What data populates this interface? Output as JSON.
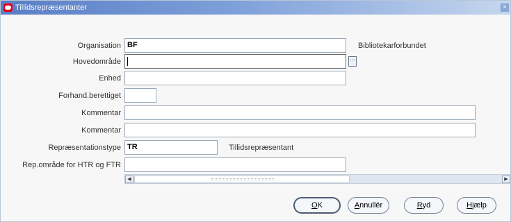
{
  "window": {
    "title": "Tillidsrepræsentanter",
    "close_glyph": "×"
  },
  "form": {
    "organisation": {
      "label": "Organisation",
      "value": "BF",
      "description": "Bibliotekarforbundet"
    },
    "hovedomraade": {
      "label": "Hovedområde",
      "value": "",
      "lov_glyph": "···"
    },
    "enhed": {
      "label": "Enhed",
      "value": ""
    },
    "forhand": {
      "label": "Forhand.berettiget",
      "value": ""
    },
    "kommentar1": {
      "label": "Kommentar",
      "value": ""
    },
    "kommentar2": {
      "label": "Kommentar",
      "value": ""
    },
    "repraesentationstype": {
      "label": "Repræsentationstype",
      "value": "TR",
      "description": "Tillidsrepræsentant"
    },
    "repomraade": {
      "label": "Rep.område for HTR og FTR",
      "value": ""
    }
  },
  "scrollbar": {
    "left_glyph": "◀",
    "right_glyph": "▶"
  },
  "buttons": {
    "ok_mnemonic": "O",
    "ok_rest": "K",
    "annuller_mnemonic": "A",
    "annuller_rest": "nnullér",
    "ryd_mnemonic": "R",
    "ryd_rest": "yd",
    "hjaelp_mnemonic": "H",
    "hjaelp_rest": "jælp"
  }
}
